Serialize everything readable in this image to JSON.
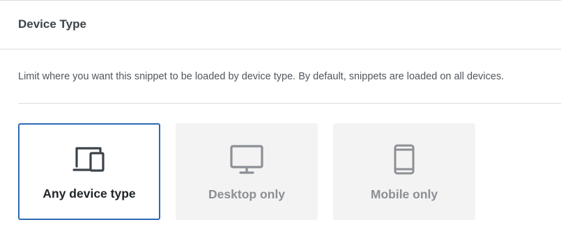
{
  "section": {
    "title": "Device Type",
    "description": "Limit where you want this snippet to be loaded by device type. By default, snippets are loaded on all devices."
  },
  "options": [
    {
      "label": "Any device type",
      "icon": "devices-icon",
      "selected": true
    },
    {
      "label": "Desktop only",
      "icon": "desktop-icon",
      "selected": false
    },
    {
      "label": "Mobile only",
      "icon": "mobile-icon",
      "selected": false
    }
  ],
  "colors": {
    "selected_border": "#2d6ab3",
    "selected_text": "#1d2327",
    "unselected_bg": "#f3f3f3",
    "unselected_text": "#8c8f94",
    "icon_selected": "#3c434a",
    "icon_unselected": "#8c8f94"
  }
}
